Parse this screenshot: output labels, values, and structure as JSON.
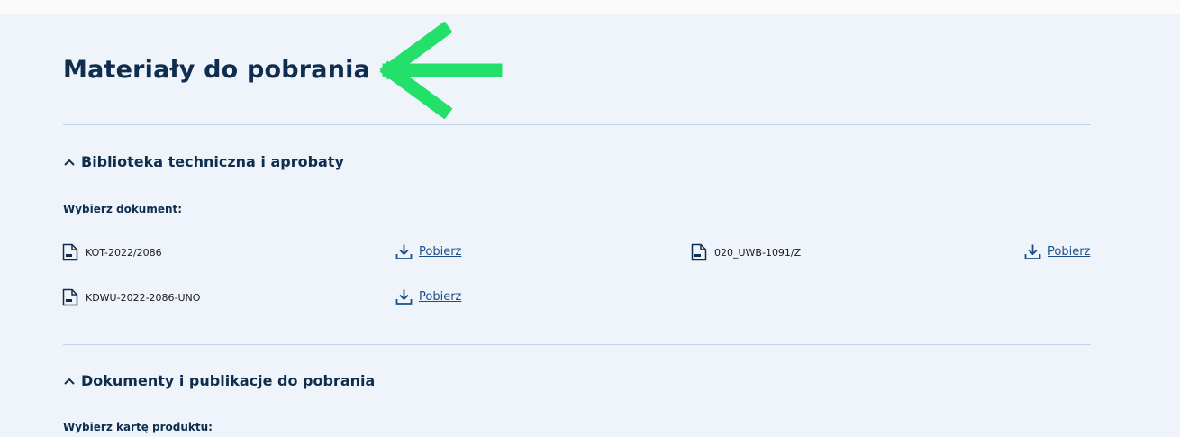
{
  "page": {
    "title": "Materiały do pobrania"
  },
  "sections": [
    {
      "heading": "Biblioteka techniczna i aprobaty",
      "sublabel": "Wybierz dokument:",
      "documents": [
        {
          "name": "KOT-2022/2086",
          "download_label": "Pobierz"
        },
        {
          "name": "020_UWB-1091/Z",
          "download_label": "Pobierz"
        },
        {
          "name": "KDWU-2022-2086-UNO",
          "download_label": "Pobierz"
        }
      ]
    },
    {
      "heading": "Dokumenty i publikacje do pobrania",
      "sublabel": "Wybierz kartę produktu:"
    }
  ],
  "colors": {
    "arrow": "#22e06a",
    "navy": "#0f2e4f",
    "panel": "#eff4fb",
    "link": "#1a4f8a"
  }
}
